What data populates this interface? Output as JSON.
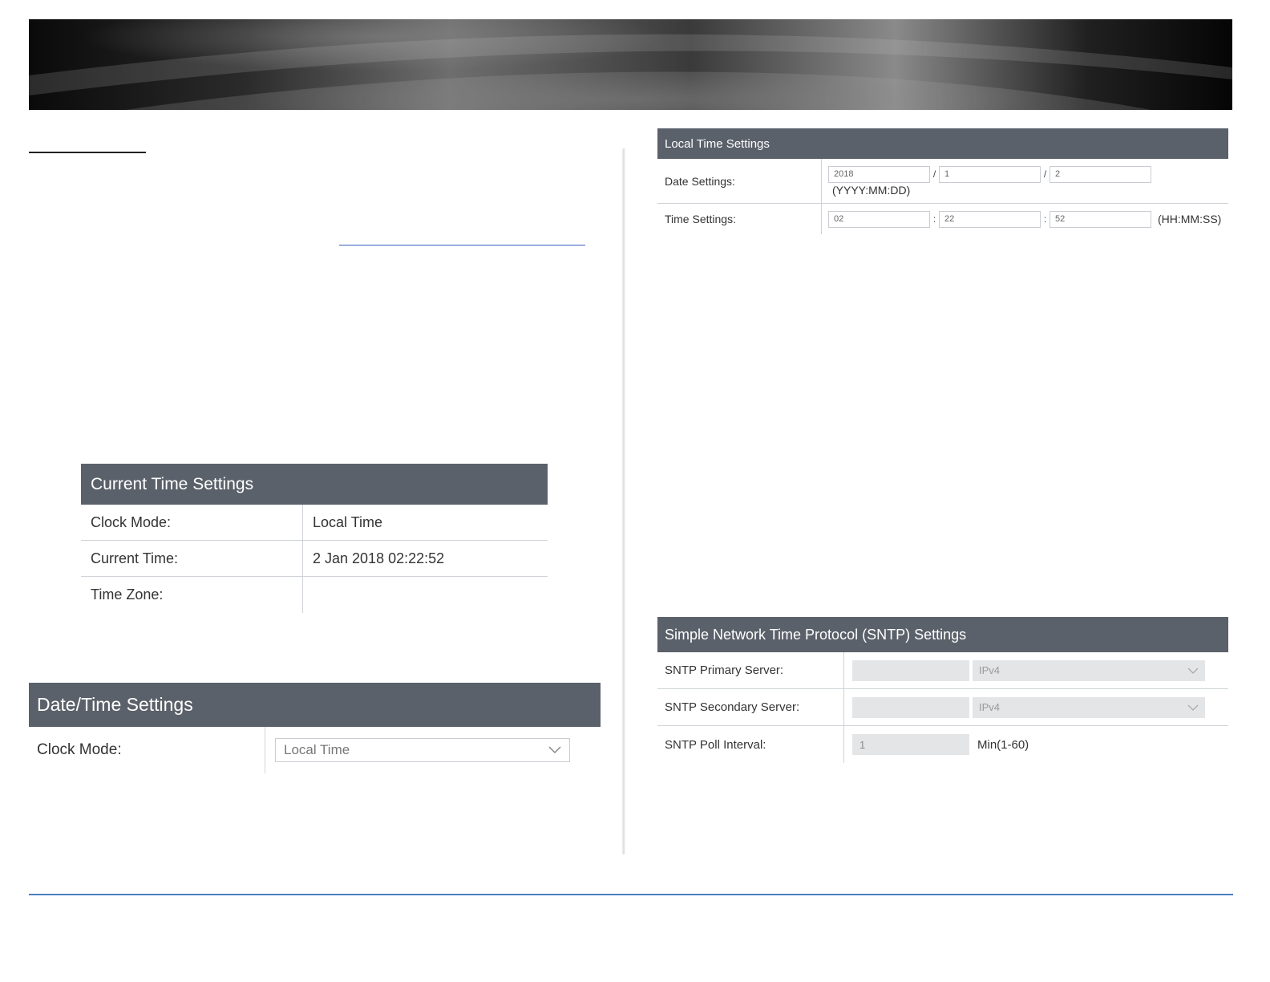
{
  "current_time_settings": {
    "title": "Current Time Settings",
    "rows": [
      {
        "label": "Clock Mode:",
        "value": "Local Time"
      },
      {
        "label": "Current Time:",
        "value": "2 Jan 2018 02:22:52"
      },
      {
        "label": "Time Zone:",
        "value": ""
      }
    ]
  },
  "datetime_settings": {
    "title": "Date/Time Settings",
    "clock_mode_label": "Clock Mode:",
    "clock_mode_value": "Local Time",
    "chevron_icon": "chevron-down-icon"
  },
  "local_time_settings": {
    "title": "Local Time Settings",
    "date_label": "Date Settings:",
    "date_year": "2018",
    "date_month": "1",
    "date_day": "2",
    "date_sep": "/",
    "date_format": "(YYYY:MM:DD)",
    "time_label": "Time Settings:",
    "time_hour": "02",
    "time_minute": "22",
    "time_second": "52",
    "time_sep": ":",
    "time_format": "(HH:MM:SS)"
  },
  "sntp_settings": {
    "title": "Simple Network Time Protocol (SNTP) Settings",
    "primary_label": "SNTP Primary Server:",
    "primary_value": "",
    "primary_type": "IPv4",
    "secondary_label": "SNTP Secondary Server:",
    "secondary_value": "",
    "secondary_type": "IPv4",
    "poll_label": "SNTP Poll Interval:",
    "poll_value": "1",
    "poll_unit": "Min(1-60)"
  },
  "colors": {
    "panel_header": "#5b616a",
    "footer_line": "#4a7fc0"
  }
}
